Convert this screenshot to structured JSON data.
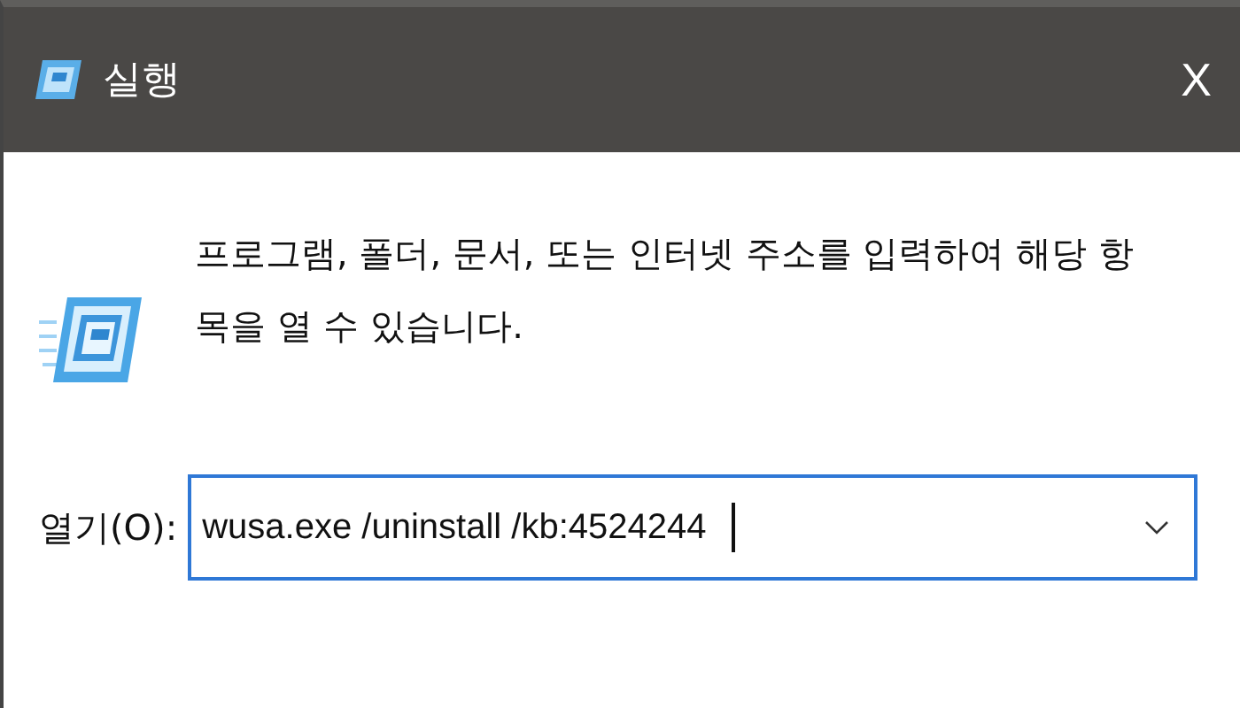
{
  "window": {
    "title": "실행",
    "close": "X"
  },
  "description_lines": [
    "프로그램, 폴더, 문서, 또는 인터넷 주소를 입력하여 해당 항",
    "목을 열 수 있습니다."
  ],
  "open_field": {
    "label": "열기(O):",
    "value": "wusa.exe /uninstall /kb:4524244",
    "focused": true
  }
}
